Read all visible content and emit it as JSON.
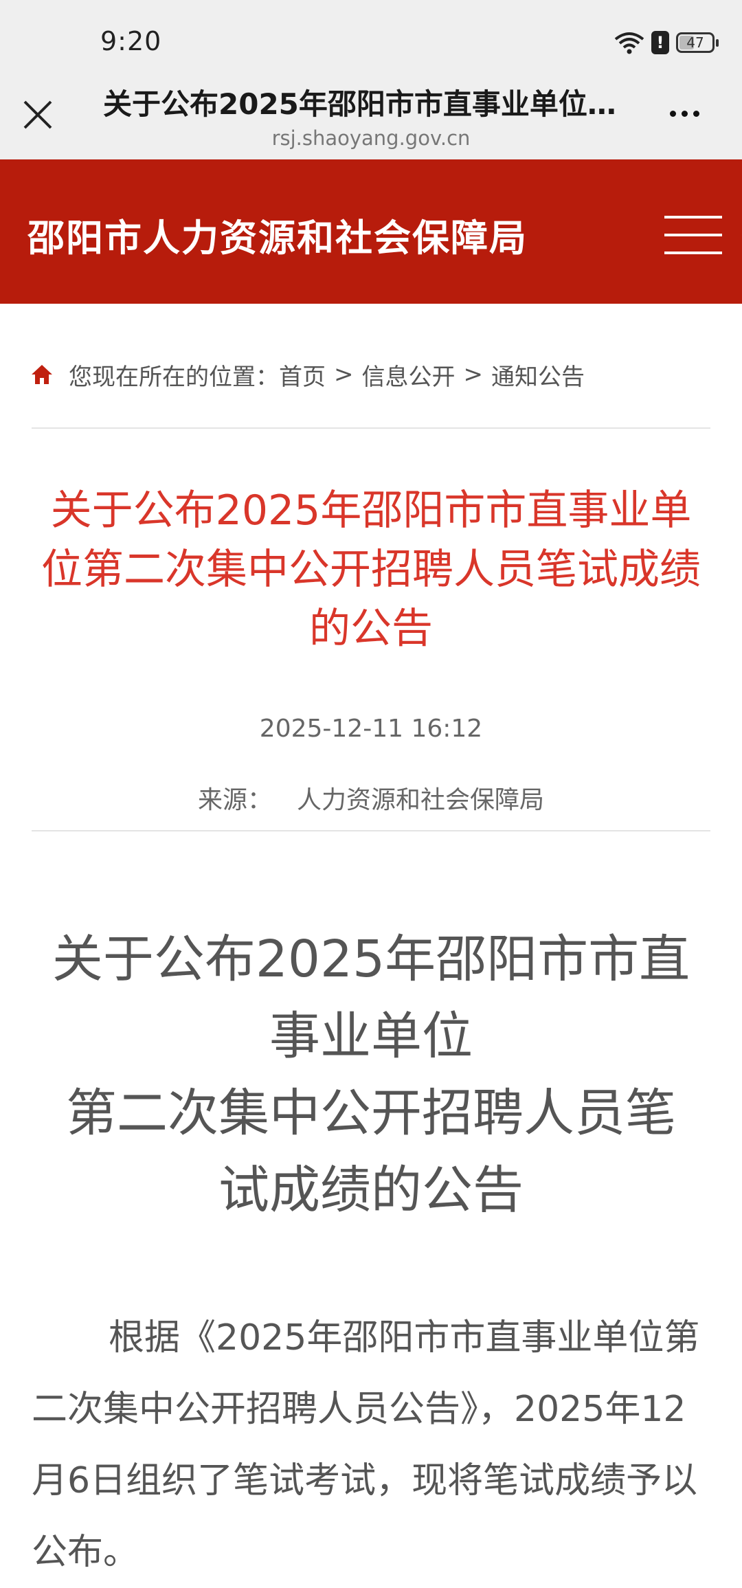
{
  "status_bar": {
    "time": "9:20",
    "battery": "47",
    "battery_level_percent": 47
  },
  "browser": {
    "page_title": "关于公布2025年邵阳市市直事业单位第二次集中公开招聘人员笔试成绩的公告",
    "url": "rsj.shaoyang.gov.cn",
    "icons": [
      "close-icon",
      "more-icon"
    ]
  },
  "site": {
    "name": "邵阳市人力资源和社会保障局",
    "menu_icon": "hamburger-menu-icon"
  },
  "breadcrumb": {
    "prefix": "您现在所在的位置：",
    "items": [
      "首页",
      "信息公开",
      "通知公告"
    ],
    "separator": ">"
  },
  "article": {
    "title": "关于公布2025年邵阳市市直事业单位第二次集中公开招聘人员笔试成绩的公告",
    "date": "2025-12-11 16:12",
    "source_label": "来源：",
    "source_value": "人力资源和社会保障局",
    "body_title_lines": [
      "关于公布2025年邵阳市市直",
      "事业单位",
      "第二次集中公开招聘人员笔",
      "试成绩的公告"
    ],
    "paragraph": "根据《2025年邵阳市市直事业单位第二次集中公开招聘人员公告》，2025年12月6日组织了笔试考试，现将笔试成绩予以公布。"
  },
  "colors": {
    "header_red": "#b71c0c",
    "title_red": "#d9362a"
  }
}
